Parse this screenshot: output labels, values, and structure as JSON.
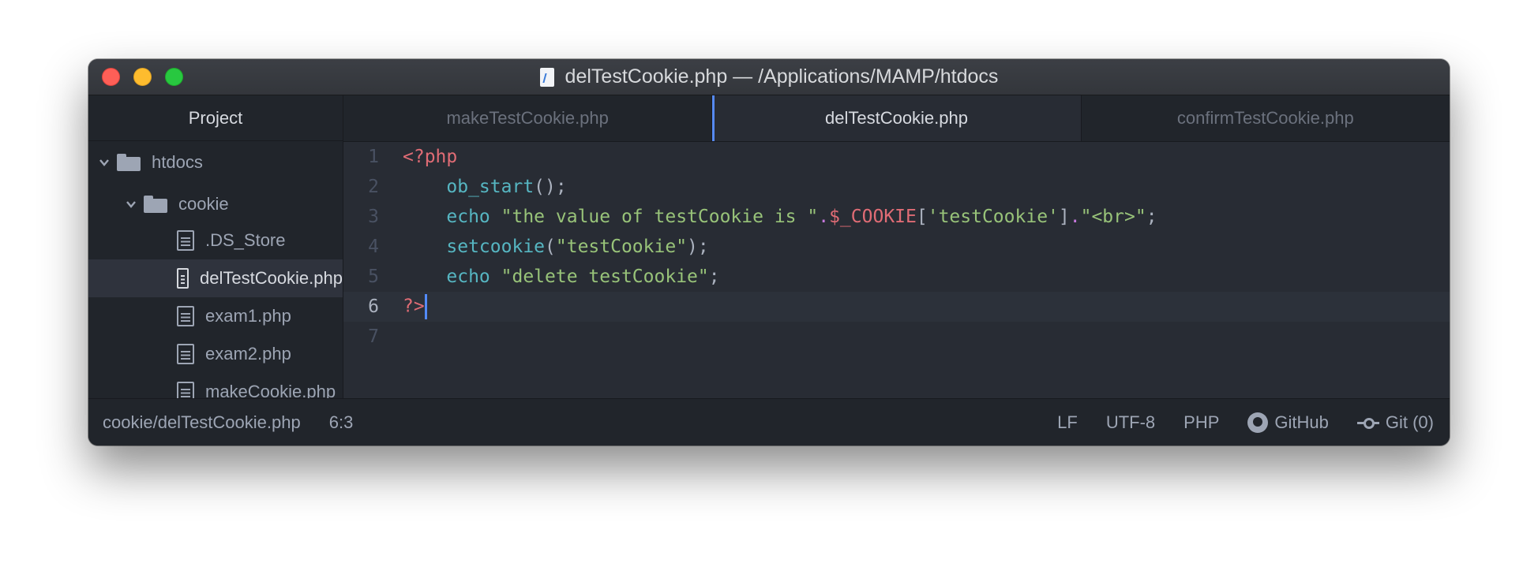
{
  "window": {
    "title": "delTestCookie.php — /Applications/MAMP/htdocs"
  },
  "sidebar": {
    "header": "Project",
    "tree": [
      {
        "label": "htdocs",
        "type": "folder",
        "expanded": true
      },
      {
        "label": "cookie",
        "type": "folder",
        "expanded": true
      },
      {
        "label": ".DS_Store",
        "type": "file"
      },
      {
        "label": "delTestCookie.php",
        "type": "file",
        "selected": true
      },
      {
        "label": "exam1.php",
        "type": "file"
      },
      {
        "label": "exam2.php",
        "type": "file"
      },
      {
        "label": "makeCookie.php",
        "type": "file"
      }
    ]
  },
  "tabs": [
    {
      "label": "makeTestCookie.php",
      "active": false
    },
    {
      "label": "delTestCookie.php",
      "active": true
    },
    {
      "label": "confirmTestCookie.php",
      "active": false
    }
  ],
  "editor": {
    "line_numbers": [
      "1",
      "2",
      "3",
      "4",
      "5",
      "6",
      "7"
    ],
    "current_line": 6,
    "lines": {
      "l1": {
        "open_tag": "<?php"
      },
      "l2": {
        "fn": "ob_start",
        "rest": "();"
      },
      "l3": {
        "kw": "echo",
        "str1": "\"the value of testCookie is \"",
        "dot1": ".",
        "var": "$_COOKIE",
        "br_open": "[",
        "key": "'testCookie'",
        "br_close": "]",
        "dot2": ".",
        "str2": "\"<br>\"",
        "semi": ";"
      },
      "l4": {
        "fn": "setcookie",
        "paren_open": "(",
        "str": "\"testCookie\"",
        "paren_close": ");"
      },
      "l5": {
        "kw": "echo",
        "str": "\"delete testCookie\"",
        "semi": ";"
      },
      "l6": {
        "close_tag": "?>"
      }
    }
  },
  "status": {
    "path": "cookie/delTestCookie.php",
    "cursor": "6:3",
    "line_ending": "LF",
    "encoding": "UTF-8",
    "grammar": "PHP",
    "github": "GitHub",
    "git": "Git (0)"
  },
  "colors": {
    "accent": "#568af2",
    "tag": "#e06c75",
    "function": "#56b6c2",
    "string": "#98c379",
    "operator": "#c678dd"
  }
}
